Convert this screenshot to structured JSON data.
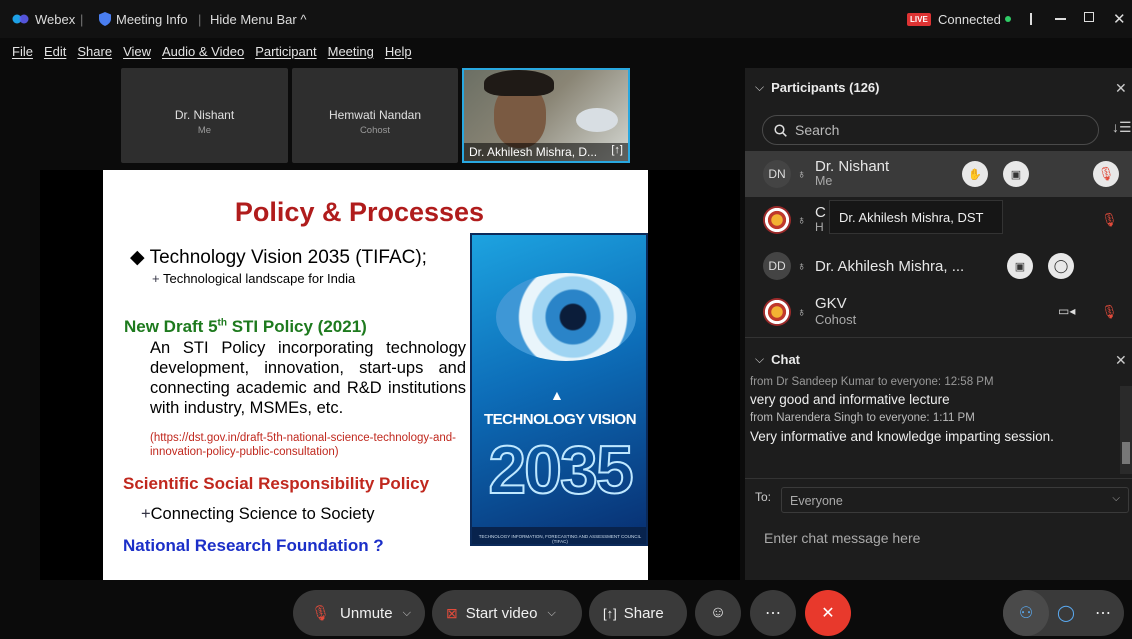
{
  "titlebar": {
    "app": "Webex",
    "meeting_info": "Meeting Info",
    "hide_menu": "Hide Menu Bar ^",
    "live": "LIVE",
    "connected": "Connected"
  },
  "menu": [
    "File",
    "Edit",
    "Share",
    "View",
    "Audio & Video",
    "Participant",
    "Meeting",
    "Help"
  ],
  "tiles": [
    {
      "name": "Dr. Nishant",
      "sub": "Me"
    },
    {
      "name": "Hemwati Nandan",
      "sub": "Cohost"
    },
    {
      "name": "Dr. Akhilesh Mishra, D..."
    }
  ],
  "slide": {
    "title": "Policy & Processes",
    "b1": "Technology Vision 2035 (TIFAC);",
    "b1s": "Technological landscape for India",
    "h2a": "New Draft 5",
    "h2sup": "th",
    "h2b": " STI Policy (2021)",
    "p1": "An STI Policy incorporating technology development, innovation, start-ups and connecting academic and R&D institutions with industry, MSMEs, etc.",
    "link": "(https://dst.gov.in/draft-5th-national-science-technology-and-innovation-policy-public-consultation)",
    "h3": "Scientific Social Responsibility Policy",
    "b3": "Connecting Science to Society",
    "h4": "National Research Foundation ?",
    "book_top": "TECHNOLOGY VISION",
    "book_year": "2035",
    "book_foot": "TECHNOLOGY INFORMATION, FORECASTING AND ASSESSMENT COUNCIL (TIFAC)"
  },
  "participants": {
    "header": "Participants (126)",
    "search_placeholder": "Search",
    "list": [
      {
        "initials": "DN",
        "name": "Dr. Nishant",
        "role": "Me"
      },
      {
        "initials": "",
        "name": "C",
        "role": "H"
      },
      {
        "initials": "DD",
        "name": "Dr. Akhilesh Mishra, ...",
        "role": ""
      },
      {
        "initials": "",
        "name": "GKV",
        "role": "Cohost"
      }
    ],
    "tooltip": "Dr. Akhilesh Mishra, DST"
  },
  "chat": {
    "header": "Chat",
    "cut": "from Dr Sandeep Kumar to everyone:   12:58 PM",
    "m1": "very good and informative lecture",
    "s2": "from Narendera Singh to everyone:   1:11 PM",
    "m2": "Very informative and knowledge  imparting session.",
    "to_label": "To:",
    "to_value": "Everyone",
    "placeholder": "Enter chat message here"
  },
  "toolbar": {
    "unmute": "Unmute",
    "start_video": "Start video",
    "share": "Share"
  }
}
